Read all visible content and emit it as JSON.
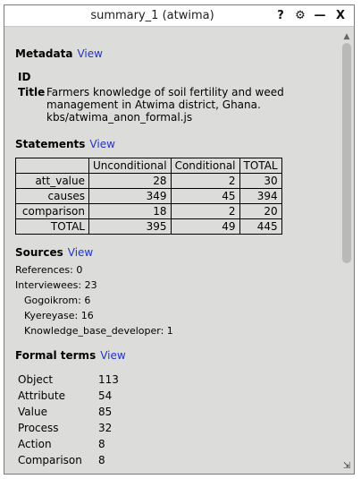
{
  "window": {
    "title": "summary_1 (atwima)",
    "help_label": "?",
    "settings_label": "⚙",
    "minimize_label": "—",
    "close_label": "X"
  },
  "metadata": {
    "heading": "Metadata",
    "view_label": "View",
    "id_label": "ID",
    "id_value": "",
    "title_label": "Title",
    "title_value": "Farmers knowledge of soil fertility and weed management in Atwima district, Ghana. kbs/atwima_anon_formal.js"
  },
  "statements": {
    "heading": "Statements",
    "view_label": "View",
    "columns": [
      "",
      "Unconditional",
      "Conditional",
      "TOTAL"
    ],
    "rows": [
      {
        "label": "att_value",
        "unconditional": "28",
        "conditional": "2",
        "total": "30"
      },
      {
        "label": "causes",
        "unconditional": "349",
        "conditional": "45",
        "total": "394"
      },
      {
        "label": "comparison",
        "unconditional": "18",
        "conditional": "2",
        "total": "20"
      },
      {
        "label": "TOTAL",
        "unconditional": "395",
        "conditional": "49",
        "total": "445"
      }
    ]
  },
  "sources": {
    "heading": "Sources",
    "view_label": "View",
    "references": "References: 0",
    "interviewees": "Interviewees: 23",
    "items": [
      "Gogoikrom: 6",
      "Kyereyase: 16",
      "Knowledge_base_developer: 1"
    ]
  },
  "formal_terms": {
    "heading": "Formal terms",
    "view_label": "View",
    "rows": [
      {
        "term": "Object",
        "count": "113"
      },
      {
        "term": "Attribute",
        "count": "54"
      },
      {
        "term": "Value",
        "count": "85"
      },
      {
        "term": "Process",
        "count": "32"
      },
      {
        "term": "Action",
        "count": "8"
      },
      {
        "term": "Comparison",
        "count": "8"
      }
    ]
  },
  "icons": {
    "scroll_up": "scroll-up-arrow-icon",
    "resize": "resize-grip-icon"
  }
}
